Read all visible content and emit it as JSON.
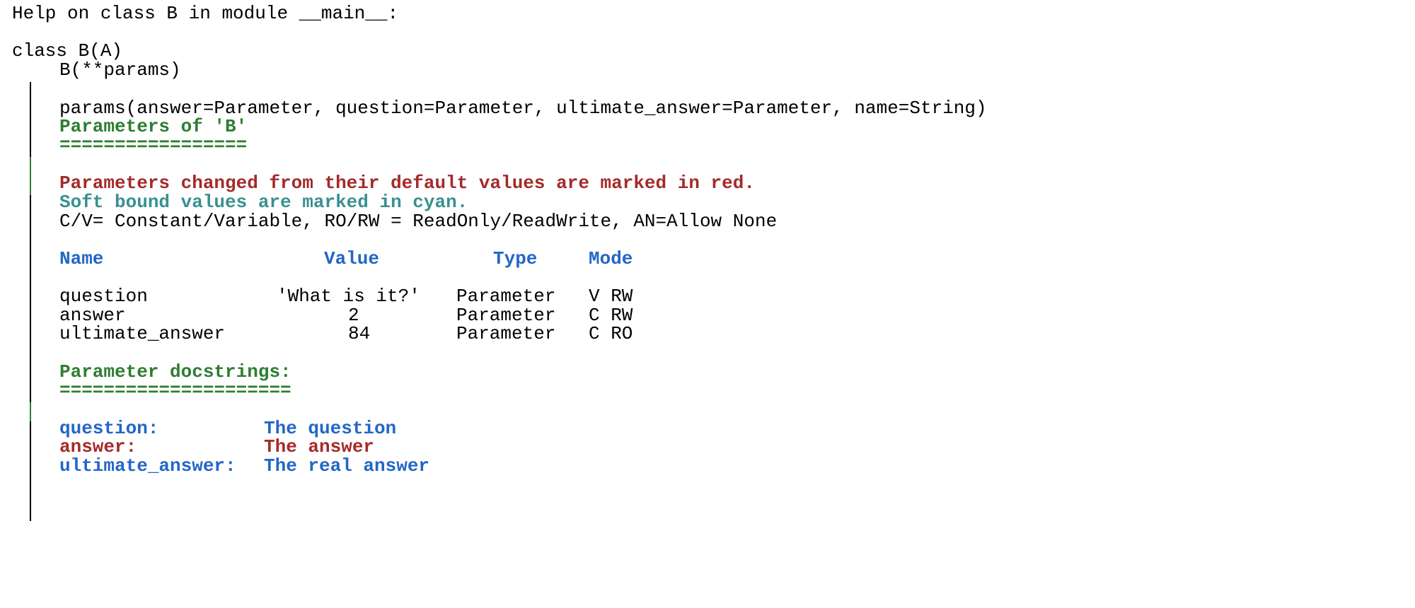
{
  "colors": {
    "text": "#000000",
    "green": "#2e7d32",
    "red": "#a52a2a",
    "cyan": "#3a9090",
    "blue": "#2366c7",
    "bar": "#000000",
    "bar_green": "#2e7d32"
  },
  "header": {
    "help_line": "Help on class B in module __main__:",
    "class_def": "class B(A)"
  },
  "body": {
    "signature": "B(**params)",
    "params_sig": "params(answer=Parameter, question=Parameter, ultimate_answer=Parameter, name=String)",
    "params_title": "Parameters of 'B'",
    "params_underline": "=================",
    "changed_note": "Parameters changed from their default values are marked in red.",
    "soft_bound_note": "Soft bound values are marked in cyan.",
    "legend_note": "C/V= Constant/Variable, RO/RW = ReadOnly/ReadWrite, AN=Allow None"
  },
  "params_table": {
    "headers": [
      "Name",
      "Value",
      "Type",
      "Mode"
    ],
    "rows": [
      {
        "name": "question",
        "value": "'What is it?'",
        "type": "Parameter",
        "mode": "V RW"
      },
      {
        "name": "answer",
        "value": "2",
        "type": "Parameter",
        "mode": "C RW"
      },
      {
        "name": "ultimate_answer",
        "value": "84",
        "type": "Parameter",
        "mode": "C RO"
      }
    ]
  },
  "docstrings": {
    "title": "Parameter docstrings:",
    "underline": "=====================",
    "entries": [
      {
        "name": "question:",
        "doc": "The question",
        "color": "#2366c7"
      },
      {
        "name": "answer:",
        "doc": "The answer",
        "color": "#a52a2a"
      },
      {
        "name": "ultimate_answer:",
        "doc": "The real answer",
        "color": "#2366c7"
      }
    ]
  }
}
